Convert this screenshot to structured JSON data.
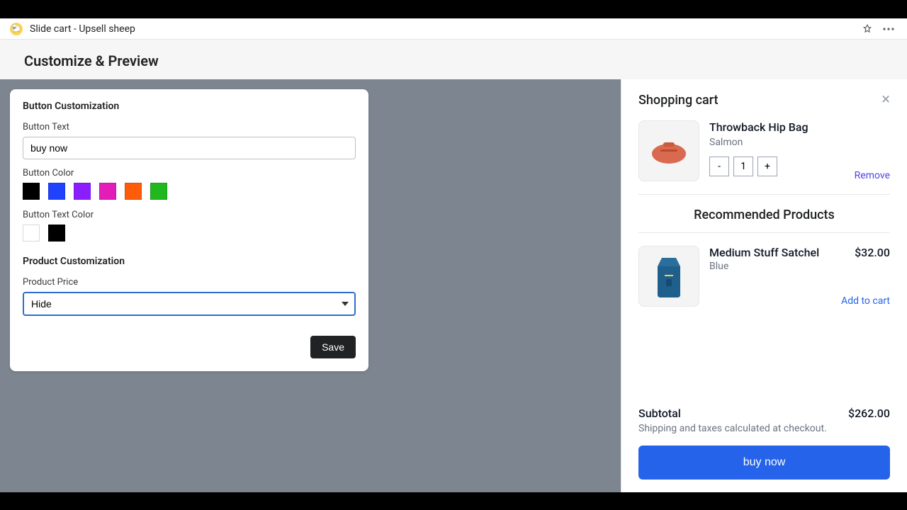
{
  "titlebar": {
    "app_name": "Slide cart - Upsell sheep"
  },
  "subheader": "Customize & Preview",
  "panel": {
    "section_button": "Button Customization",
    "button_text_label": "Button Text",
    "button_text_value": "buy now",
    "button_color_label": "Button Color",
    "button_colors": [
      "#000000",
      "#1e42ff",
      "#8b1eff",
      "#e31eb8",
      "#ff5c0a",
      "#21b81e"
    ],
    "button_text_color_label": "Button Text Color",
    "button_text_colors": [
      "#ffffff",
      "#000000"
    ],
    "section_product": "Product Customization",
    "product_price_label": "Product Price",
    "product_price_value": "Hide",
    "save_label": "Save"
  },
  "cart": {
    "title": "Shopping cart",
    "item": {
      "name": "Throwback Hip Bag",
      "variant": "Salmon",
      "qty_minus": "-",
      "qty": "1",
      "qty_plus": "+",
      "remove": "Remove"
    },
    "recommended_title": "Recommended Products",
    "rec": {
      "name": "Medium Stuff Satchel",
      "variant": "Blue",
      "price": "$32.00",
      "add": "Add to cart"
    },
    "subtotal_label": "Subtotal",
    "subtotal_value": "$262.00",
    "shipping_note": "Shipping and taxes calculated at checkout.",
    "checkout_label": "buy now"
  }
}
